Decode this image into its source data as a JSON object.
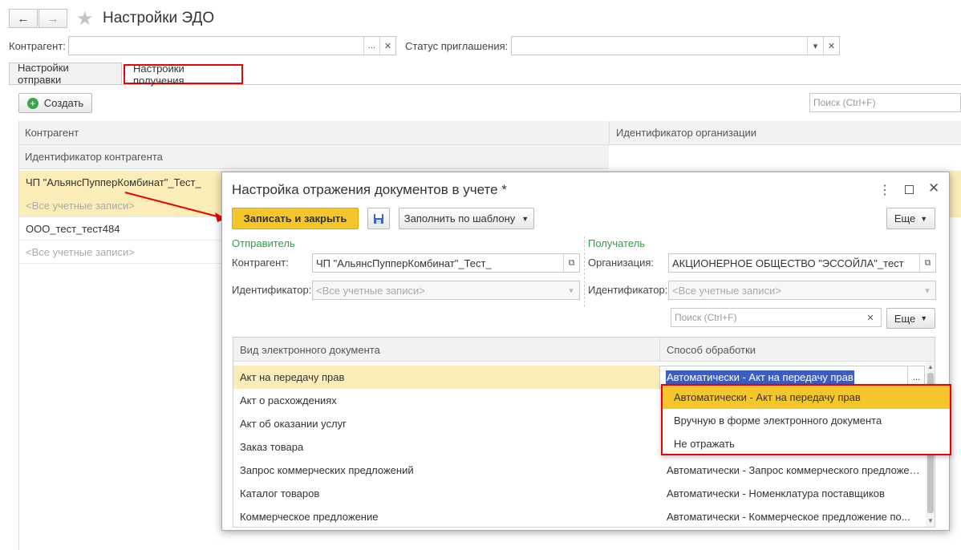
{
  "window": {
    "title": "Настройки ЭДО",
    "back_icon": "arrow-left-icon",
    "forward_icon": "arrow-right-icon",
    "star_icon": "star-icon"
  },
  "filters": {
    "counterparty_label": "Контрагент:",
    "counterparty_value": "",
    "invitation_status_label": "Статус приглашения:",
    "invitation_status_value": ""
  },
  "tabs": [
    {
      "label": "Настройки отправки",
      "active": false
    },
    {
      "label": "Настройки получения",
      "active": true
    }
  ],
  "toolbar": {
    "create_label": "Создать",
    "search_placeholder": "Поиск (Ctrl+F)"
  },
  "grid": {
    "columns": [
      "Контрагент",
      "Идентификатор организации"
    ],
    "subcolumn": "Идентификатор контрагента",
    "rows": [
      {
        "counterparty": "ЧП \"АльянсПупперКомбинат\"_Тест_",
        "identifier": "<Все учетные записи>",
        "selected": true
      },
      {
        "counterparty": "ООО_тест_тест484",
        "identifier": "<Все учетные записи>",
        "selected": false
      }
    ]
  },
  "dialog": {
    "title": "Настройка отражения документов в учете *",
    "save_close_label": "Записать и закрыть",
    "fill_template_label": "Заполнить по шаблону",
    "more_label": "Еще",
    "sender": {
      "section_label": "Отправитель",
      "counterparty_label": "Контрагент:",
      "counterparty_value": "ЧП \"АльянсПупперКомбинат\"_Тест_",
      "identifier_label": "Идентификатор:",
      "identifier_value": "<Все учетные записи>"
    },
    "recipient": {
      "section_label": "Получатель",
      "organization_label": "Организация:",
      "organization_value": "АКЦИОНЕРНОЕ ОБЩЕСТВО \"ЭССОЙЛА\"_тест",
      "identifier_label": "Идентификатор:",
      "identifier_value": "<Все учетные записи>"
    },
    "search_placeholder": "Поиск (Ctrl+F)",
    "more2_label": "Еще",
    "table": {
      "columns": [
        "Вид электронного документа",
        "Способ обработки"
      ],
      "rows": [
        {
          "doc": "Акт на передачу прав",
          "method": "Автоматически -  Акт на передачу прав"
        },
        {
          "doc": "Акт о расхождениях",
          "method": ""
        },
        {
          "doc": "Акт об оказании услуг",
          "method": ""
        },
        {
          "doc": "Заказ товара",
          "method": ""
        },
        {
          "doc": "Запрос коммерческих предложений",
          "method": "Автоматически -  Запрос коммерческого предложения"
        },
        {
          "doc": "Каталог товаров",
          "method": "Автоматически -  Номенклатура поставщиков"
        },
        {
          "doc": "Коммерческое предложение",
          "method": "Автоматически -  Коммерческое предложение по..."
        }
      ]
    },
    "dropdown_options": [
      "Автоматически -  Акт на передачу прав",
      "Вручную в форме электронного документа",
      "Не отражать"
    ]
  },
  "colors": {
    "accent_yellow": "#f5c52c",
    "selected_row": "#fbedb7",
    "highlight_red": "#e00000",
    "section_green": "#2f9e44",
    "text_selection": "#3b5ec6"
  }
}
